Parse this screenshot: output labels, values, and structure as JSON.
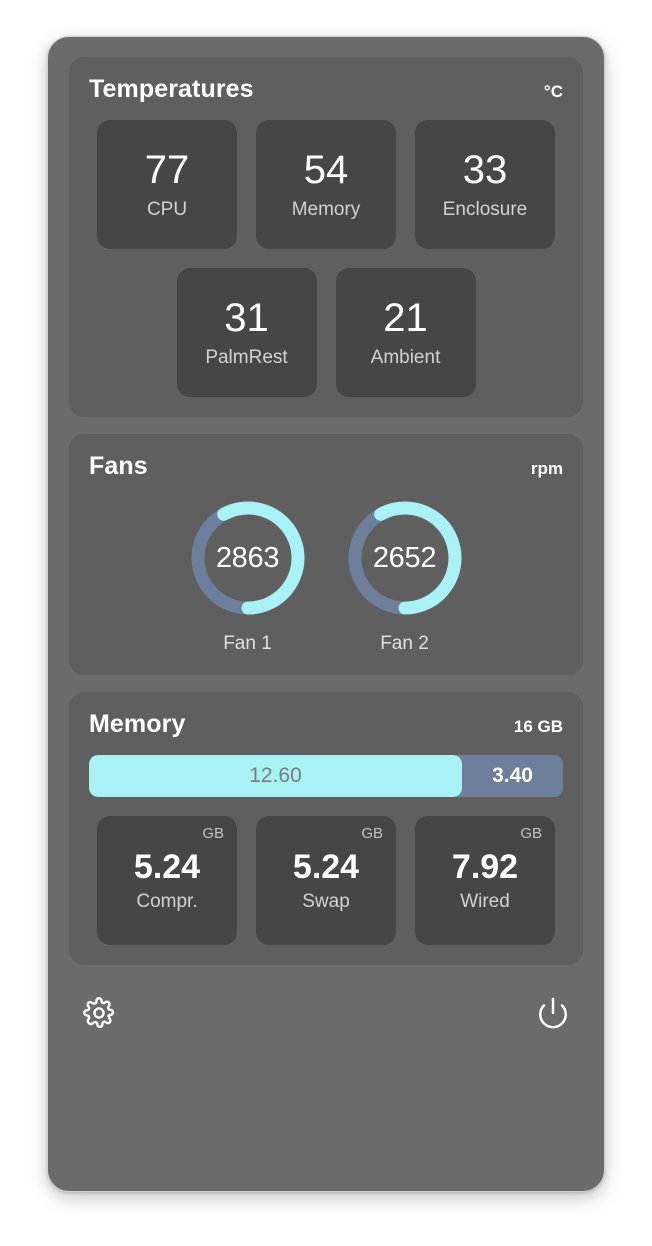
{
  "window": {
    "accent_cyan": "#a8f2f6",
    "track_slate": "#6e7f9b",
    "card_bg": "#5f5f5f",
    "tile_bg": "#464646",
    "window_bg": "#6b6b6b"
  },
  "temperatures": {
    "title": "Temperatures",
    "unit": "°C",
    "row1": [
      {
        "value": "77",
        "label": "CPU"
      },
      {
        "value": "54",
        "label": "Memory"
      },
      {
        "value": "33",
        "label": "Enclosure"
      }
    ],
    "row2": [
      {
        "value": "31",
        "label": "PalmRest"
      },
      {
        "value": "21",
        "label": "Ambient"
      }
    ]
  },
  "fans": {
    "title": "Fans",
    "unit": "rpm",
    "gauges": [
      {
        "value": "2863",
        "label": "Fan 1",
        "percent": 58
      },
      {
        "value": "2652",
        "label": "Fan 2",
        "percent": 58
      }
    ]
  },
  "memory": {
    "title": "Memory",
    "total": "16 GB",
    "bar": {
      "used_value": "12.60",
      "free_value": "3.40",
      "used_percent": 78.7
    },
    "tiles": [
      {
        "unit": "GB",
        "value": "5.24",
        "label": "Compr."
      },
      {
        "unit": "GB",
        "value": "5.24",
        "label": "Swap"
      },
      {
        "unit": "GB",
        "value": "7.92",
        "label": "Wired"
      }
    ]
  },
  "footer": {
    "settings_icon": "gear-icon",
    "power_icon": "power-icon"
  }
}
